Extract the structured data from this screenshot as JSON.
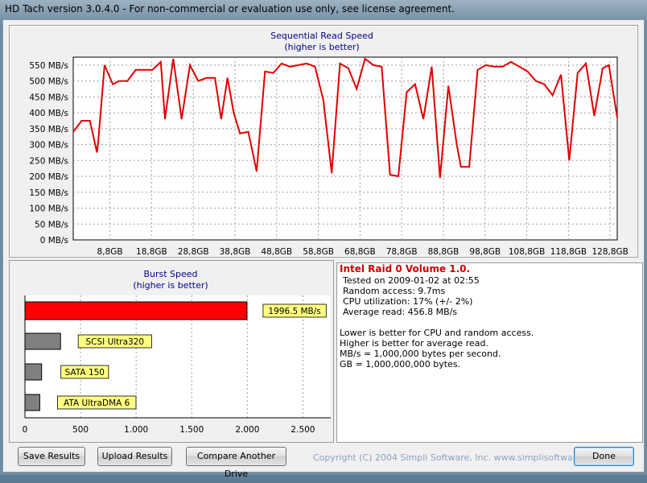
{
  "window": {
    "title": "HD Tach version 3.0.4.0  - For non-commercial or evaluation use only, see license agreement."
  },
  "read_chart": {
    "title": "Sequential Read Speed",
    "subtitle": "(higher is better)",
    "line_color": "#e00000",
    "y_ticks": [
      "0 MB/s",
      "50 MB/s",
      "100 MB/s",
      "150 MB/s",
      "200 MB/s",
      "250 MB/s",
      "300 MB/s",
      "350 MB/s",
      "400 MB/s",
      "450 MB/s",
      "500 MB/s",
      "550 MB/s"
    ],
    "x_ticks": [
      "8,8GB",
      "18,8GB",
      "28,8GB",
      "38,8GB",
      "48,8GB",
      "58,8GB",
      "68,8GB",
      "78,8GB",
      "88,8GB",
      "98,8GB",
      "108,8GB",
      "118,8GB",
      "128,8GB"
    ]
  },
  "burst_chart": {
    "title": "Burst Speed",
    "subtitle": "(higher is better)",
    "x_ticks": [
      "0",
      "500",
      "1.000",
      "1.500",
      "2.000",
      "2.500"
    ]
  },
  "chart_data": [
    {
      "type": "line",
      "title": "Sequential Read Speed",
      "subtitle": "(higher is better)",
      "ylabel": "",
      "xlabel": "",
      "ylim": [
        0,
        575
      ],
      "xlim": [
        0,
        130.5
      ],
      "grid": true,
      "x": [
        0,
        2,
        4,
        5.7,
        6,
        7.5,
        9.5,
        11,
        13,
        15,
        17,
        19,
        21,
        22,
        24,
        26,
        28,
        30,
        32,
        34,
        35.5,
        37,
        38.5,
        40,
        42,
        44,
        46,
        48,
        50,
        52,
        54,
        56,
        58,
        60,
        62,
        64,
        66,
        68,
        70,
        72,
        74,
        76,
        78,
        80,
        82,
        84,
        86,
        88,
        90,
        92,
        93,
        95,
        97,
        99,
        101,
        103,
        105,
        107,
        109,
        111,
        113,
        115,
        117,
        119,
        121,
        123,
        125,
        127,
        128.5,
        130.5
      ],
      "series": [
        {
          "values": [
            340,
            375,
            375,
            275,
            310,
            550,
            490,
            500,
            500,
            535,
            535,
            535,
            560,
            380,
            570,
            380,
            550,
            500,
            510,
            510,
            380,
            510,
            400,
            335,
            340,
            215,
            530,
            525,
            555,
            545,
            550,
            555,
            545,
            440,
            210,
            555,
            540,
            475,
            570,
            550,
            545,
            205,
            200,
            465,
            490,
            380,
            545,
            195,
            485,
            300,
            230,
            230,
            535,
            550,
            545,
            545,
            560,
            545,
            530,
            500,
            490,
            455,
            520,
            250,
            525,
            555,
            390,
            540,
            550,
            385
          ]
        }
      ]
    },
    {
      "type": "bar",
      "title": "Burst Speed",
      "subtitle": "(higher is better)",
      "xlim": [
        0,
        2750
      ],
      "categories": [
        "Intel Raid 0 Volume 1.0.",
        "SCSI Ultra320",
        "SATA 150",
        "ATA UltraDMA 6"
      ],
      "values": [
        1996.5,
        320,
        150,
        133
      ],
      "data_labels": [
        "1996.5 MB/s",
        "SCSI Ultra320",
        "SATA 150",
        "ATA UltraDMA 6"
      ],
      "colors": [
        "#ff0000",
        "#808080",
        "#808080",
        "#808080"
      ]
    }
  ],
  "info": {
    "drive_name": "Intel Raid 0 Volume 1.0.",
    "tested": "Tested on 2009-01-02 at 02:55",
    "random_access": "Random access: 9.7ms",
    "cpu": "CPU utilization: 17% (+/- 2%)",
    "avg_read": "Average read: 456.8 MB/s",
    "note1": "Lower is better for CPU and random access.",
    "note2": "Higher is better for average read.",
    "note3": "MB/s = 1,000,000 bytes per second.",
    "note4": "GB = 1,000,000,000 bytes."
  },
  "buttons": {
    "save": "Save Results",
    "upload": "Upload Results",
    "compare": "Compare Another Drive",
    "done": "Done"
  },
  "copyright": "Copyright (C) 2004 Simpli Software, Inc. www.simplisoftware.com"
}
